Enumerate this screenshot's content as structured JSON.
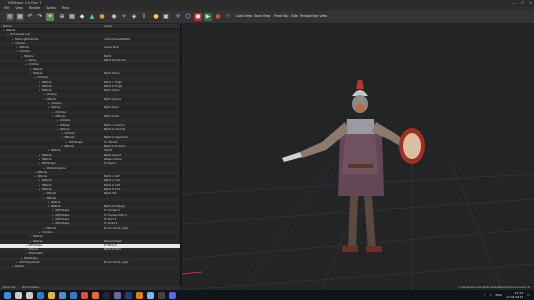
{
  "window": {
    "title": "NifSkope 2.0 Dev 7",
    "controls": [
      "—",
      "☐",
      "✕"
    ]
  },
  "menu": [
    "File",
    "View",
    "Render",
    "Spells",
    "Help"
  ],
  "toolbar": {
    "labels": [
      "Load View",
      "Save View",
      "Front",
      "Top",
      "Side",
      "Perspective View"
    ],
    "icon_colors": [
      "#4a8bd6",
      "#d64a4a",
      "#4ad68b",
      "#d6c44a"
    ]
  },
  "tree": {
    "headers": [
      "Name",
      "Value"
    ],
    "rows": [
      {
        "name": "NiNode",
        "value": "",
        "indent": 0
      },
      {
        "name": "Extra Data List",
        "value": "",
        "indent": 1
      },
      {
        "name": "NiStringExtraData",
        "value": "UniformHeadPalette",
        "indent": 2
      },
      {
        "name": "Children",
        "value": "",
        "indent": 2
      },
      {
        "name": "NiNode",
        "value": "Scene Root",
        "indent": 3
      },
      {
        "name": "Children",
        "value": "",
        "indent": 3
      },
      {
        "name": "NiNode",
        "value": "Bip01",
        "indent": 4
      },
      {
        "name": "Name",
        "value": "Bip01 NonAccum",
        "indent": 5
      },
      {
        "name": "Children",
        "value": "",
        "indent": 5
      },
      {
        "name": "NiNode",
        "value": "",
        "indent": 6
      },
      {
        "name": "NiNode",
        "value": "Bip01 Pelvis",
        "indent": 6
      },
      {
        "name": "Children",
        "value": "",
        "indent": 7
      },
      {
        "name": "NiNode",
        "value": "Bip01 L Thigh",
        "indent": 8
      },
      {
        "name": "NiNode",
        "value": "Bip01 R Thigh",
        "indent": 8
      },
      {
        "name": "NiNode",
        "value": "Bip01 Spine",
        "indent": 8
      },
      {
        "name": "Children",
        "value": "",
        "indent": 9
      },
      {
        "name": "NiNode",
        "value": "Bip01 Spine1",
        "indent": 9
      },
      {
        "name": "Children",
        "value": "",
        "indent": 10
      },
      {
        "name": "NiNode",
        "value": "Bip01 Neck",
        "indent": 10
      },
      {
        "name": "Children",
        "value": "",
        "indent": 11
      },
      {
        "name": "NiNode",
        "value": "Bip01 Head",
        "indent": 11
      },
      {
        "name": "Children",
        "value": "",
        "indent": 12
      },
      {
        "name": "NiNode",
        "value": "Bip01 L Clavicle",
        "indent": 12
      },
      {
        "name": "NiNode",
        "value": "Bip01 R Clavicle",
        "indent": 12
      },
      {
        "name": "Children",
        "value": "",
        "indent": 13
      },
      {
        "name": "NiNode",
        "value": "Bip01 R UpperArm",
        "indent": 13
      },
      {
        "name": "NiTriShape",
        "value": "Tri Helmet",
        "indent": 14
      },
      {
        "name": "NiNode",
        "value": "Bip01 R Forearm",
        "indent": 13
      },
      {
        "name": "NiNode",
        "value": "Shield",
        "indent": 10
      },
      {
        "name": "NiNode",
        "value": "Bip01 Spine2",
        "indent": 8
      },
      {
        "name": "NiNode",
        "value": "Weapon Bone",
        "indent": 8
      },
      {
        "name": "NiTriShape",
        "value": "Tri Sword",
        "indent": 8
      },
      {
        "name": "NiSkinInstance",
        "value": "",
        "indent": 9
      },
      {
        "name": "NiNode",
        "value": "",
        "indent": 7
      },
      {
        "name": "NiNode",
        "value": "Bip01 L Calf",
        "indent": 7
      },
      {
        "name": "NiNode",
        "value": "Bip01 L Foot",
        "indent": 8
      },
      {
        "name": "NiNode",
        "value": "Bip01 R Calf",
        "indent": 8
      },
      {
        "name": "NiNode",
        "value": "Bip01 R Foot",
        "indent": 8
      },
      {
        "name": "NiNode",
        "value": "Bip01 Tail",
        "indent": 9
      },
      {
        "name": "NiNode",
        "value": "",
        "indent": 9
      },
      {
        "name": "NiNode",
        "value": "",
        "indent": 10
      },
      {
        "name": "NiNode",
        "value": "Bip01 Footsteps",
        "indent": 10
      },
      {
        "name": "NiTriShape",
        "value": "Tri Cuirass 0",
        "indent": 11
      },
      {
        "name": "NiTriShape",
        "value": "Tri Cuirass Shirt 0",
        "indent": 11
      },
      {
        "name": "NiTriShape",
        "value": "Tri Skirt 0",
        "indent": 11
      },
      {
        "name": "NiTriShape",
        "value": "Tri Pants 0",
        "indent": 11
      },
      {
        "name": "NiNode",
        "value": "Environment_Light",
        "indent": 9
      },
      {
        "name": "Children",
        "value": "",
        "indent": 8
      },
      {
        "name": "NiNode",
        "value": "",
        "indent": 6
      },
      {
        "name": "NiNode",
        "value": "Skinned Mesh",
        "indent": 6
      },
      {
        "name": "NiTriShape",
        "value": "Tri Body 0",
        "indent": 5
      },
      {
        "name": "NiNode",
        "value": "Bip01 R Toe0",
        "indent": 5
      },
      {
        "name": "NiSkinData",
        "value": "",
        "indent": 5
      },
      {
        "name": "NiTriShape",
        "value": "",
        "indent": 4
      },
      {
        "name": "NiTriShapeData",
        "value": "Environment_Light",
        "indent": 3
      },
      {
        "name": "NiNode",
        "value": "",
        "indent": 2
      }
    ],
    "selected_index": 50
  },
  "viewport": {
    "status": "C:/Games/Morrowind/Data Files/Meshes/r/Imperial Guard.nif"
  },
  "statusbar": {
    "tabs": [
      "Block List",
      "Block Details"
    ]
  },
  "taskbar": {
    "icons": [
      "start-icon",
      "search-icon",
      "taskview-icon",
      "edge-icon",
      "explorer-icon",
      "store-icon",
      "mail-icon",
      "chrome-icon",
      "firefox-icon",
      "steam-icon",
      "nifskope-icon",
      "photoshop-icon",
      "blender-icon",
      "notepad-icon",
      "terminal-icon",
      "discord-icon"
    ],
    "icon_colors": [
      "#3b8be0",
      "#cccccc",
      "#cccccc",
      "#2b7cd3",
      "#e8b832",
      "#4a90d9",
      "#2b7cd3",
      "#e04b3b",
      "#e66b2b",
      "#1b2838",
      "#6a6aa0",
      "#1f3f7a",
      "#e87d0d",
      "#7ab7e8",
      "#444444",
      "#5865f2"
    ],
    "time": "21:53",
    "date": "13.04.2019",
    "language": "ENG"
  }
}
